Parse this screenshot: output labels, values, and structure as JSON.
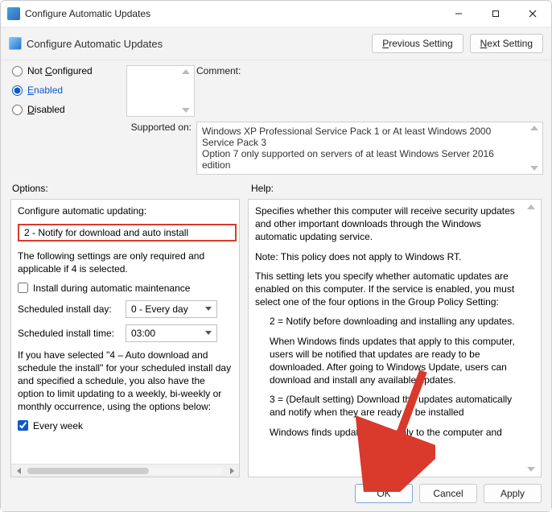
{
  "window": {
    "title": "Configure Automatic Updates"
  },
  "header": {
    "policy_title": "Configure Automatic Updates",
    "prev_label_pre": "P",
    "prev_label_rest": "revious Setting",
    "next_label_pre": "N",
    "next_label_rest": "ext Setting"
  },
  "config": {
    "not_configured_pre": "C",
    "not_configured_label": "Not ",
    "not_configured_rest": "onfigured",
    "enabled_pre": "E",
    "enabled_rest": "nabled",
    "disabled_pre": "D",
    "disabled_rest": "isabled",
    "comment_label": "Comment:",
    "supported_label": "Supported on:",
    "supported_text": "Windows XP Professional Service Pack 1 or At least Windows 2000 Service Pack 3\nOption 7 only supported on servers of at least Windows Server 2016 edition"
  },
  "labels": {
    "options": "Options:",
    "help": "Help:"
  },
  "options": {
    "heading": "Configure automatic updating:",
    "selected": "2 - Notify for download and auto install",
    "note1": "The following settings are only required and applicable if 4 is selected.",
    "chk_install_maint": "Install during automatic maintenance",
    "sched_day_label": "Scheduled install day:",
    "sched_day_value": "0 - Every day",
    "sched_time_label": "Scheduled install time:",
    "sched_time_value": "03:00",
    "note2": "If you have selected \"4 – Auto download and schedule the install\" for your scheduled install day and specified a schedule, you also have the option to limit updating to a weekly, bi-weekly or monthly occurrence, using the options below:",
    "chk_every_week": "Every week"
  },
  "help": {
    "p1": "Specifies whether this computer will receive security updates and other important downloads through the Windows automatic updating service.",
    "p2": "Note: This policy does not apply to Windows RT.",
    "p3": "This setting lets you specify whether automatic updates are enabled on this computer. If the service is enabled, you must select one of the four options in the Group Policy Setting:",
    "p4": "2 = Notify before downloading and installing any updates.",
    "p5": "When Windows finds updates that apply to this computer, users will be notified that updates are ready to be downloaded. After going to Windows Update, users can download and install any available updates.",
    "p6": "3 = (Default setting) Download the updates automatically and notify when they are ready to be installed",
    "p7": "Windows finds updates that apply to the computer and"
  },
  "footer": {
    "ok": "OK",
    "cancel": "Cancel",
    "apply": "Apply"
  }
}
